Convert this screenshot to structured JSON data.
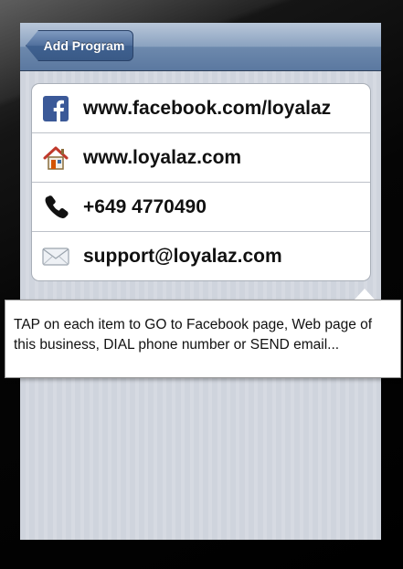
{
  "navbar": {
    "back_label": "Add Program"
  },
  "contacts": [
    {
      "icon": "facebook-icon",
      "label": "www.facebook.com/loyalaz"
    },
    {
      "icon": "home-icon",
      "label": "www.loyalaz.com"
    },
    {
      "icon": "phone-icon",
      "label": "+649 4770490"
    },
    {
      "icon": "mail-icon",
      "label": "support@loyalaz.com"
    }
  ],
  "tooltip": {
    "text": "TAP on each item to GO to Facebook page, Web page of this business, DIAL phone number or SEND email..."
  },
  "colors": {
    "navbar": "#6d89ad",
    "facebook_blue": "#3b5998",
    "background_stripes": "#cfd4dd"
  }
}
